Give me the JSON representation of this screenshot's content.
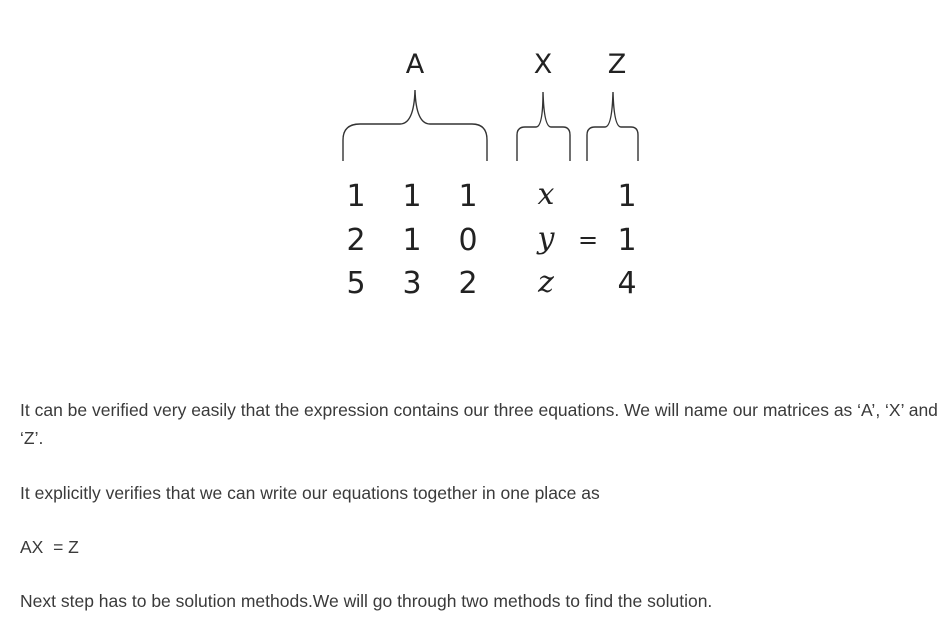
{
  "figure": {
    "labels": {
      "a": "A",
      "x": "X",
      "z": "Z"
    },
    "matrix_a": [
      [
        "1",
        "1",
        "1"
      ],
      [
        "2",
        "1",
        "0"
      ],
      [
        "5",
        "3",
        "2"
      ]
    ],
    "vector_x": [
      "x",
      "y",
      "z"
    ],
    "equals": "=",
    "vector_z": [
      "1",
      "1",
      "4"
    ]
  },
  "paragraphs": {
    "p1": "It can be verified very easily that the expression contains our three equations. We will name our matrices as ‘A’, ‘X’ and ‘Z’.",
    "p2": "It explicitly verifies that we can write our equations together in one place as",
    "p3": "AX  = Z",
    "p4": "Next step has to be solution methods.We will go through two methods to find the solution."
  }
}
